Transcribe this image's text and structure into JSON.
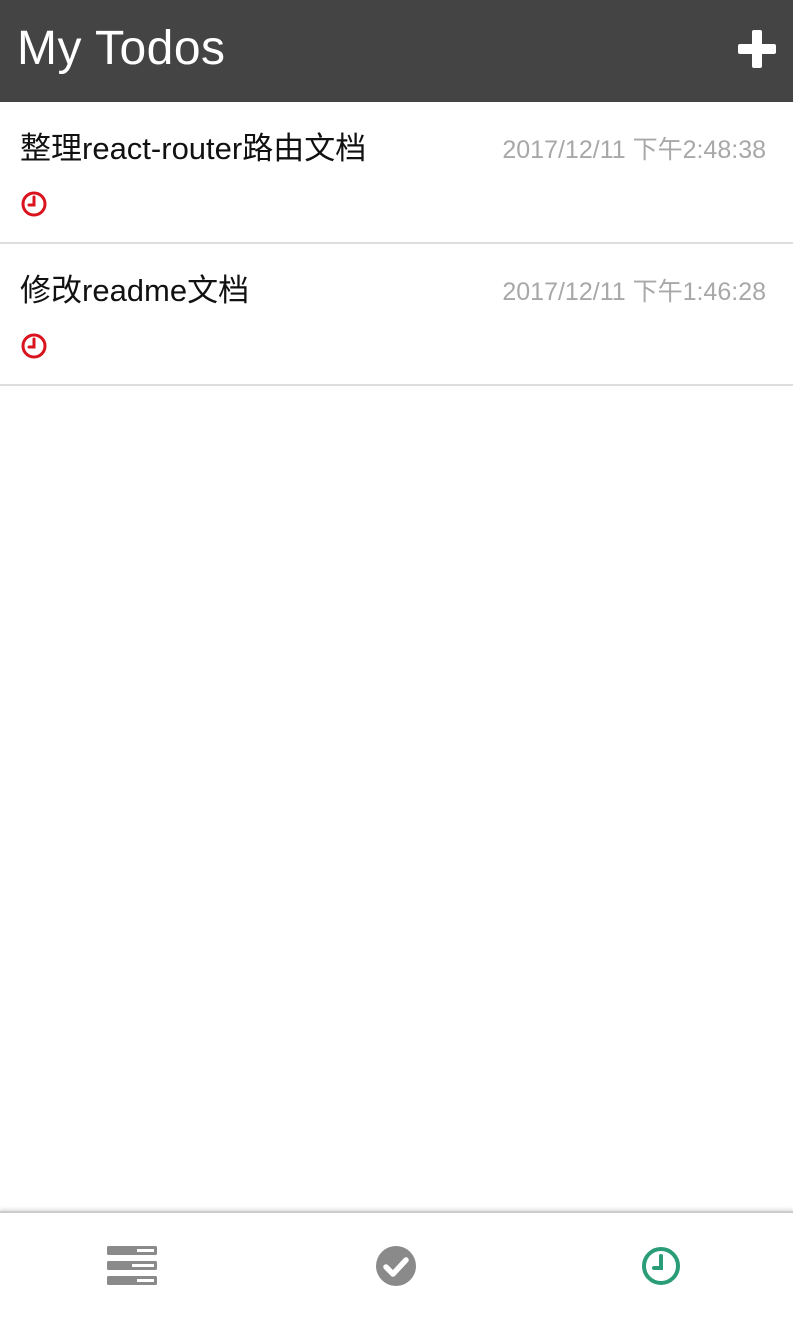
{
  "header": {
    "title": "My Todos",
    "add_icon": "plus-icon"
  },
  "todos": [
    {
      "title": "整理react-router路由文档",
      "time": "2017/12/11 下午2:48:38",
      "status_icon": "clock-icon",
      "status_color": "#d9141e"
    },
    {
      "title": "修改readme文档",
      "time": "2017/12/11 下午1:46:28",
      "status_icon": "clock-icon",
      "status_color": "#d9141e"
    }
  ],
  "tabs": [
    {
      "icon": "list-icon",
      "active": false,
      "color": "#8a8a8a"
    },
    {
      "icon": "check-circle-icon",
      "active": false,
      "color": "#8a8a8a"
    },
    {
      "icon": "clock-icon",
      "active": true,
      "color": "#2a9d78"
    }
  ],
  "colors": {
    "header_bg": "#444444",
    "accent_active": "#2a9d78",
    "pending_red": "#d9141e",
    "time_gray": "#a8a8a8"
  }
}
